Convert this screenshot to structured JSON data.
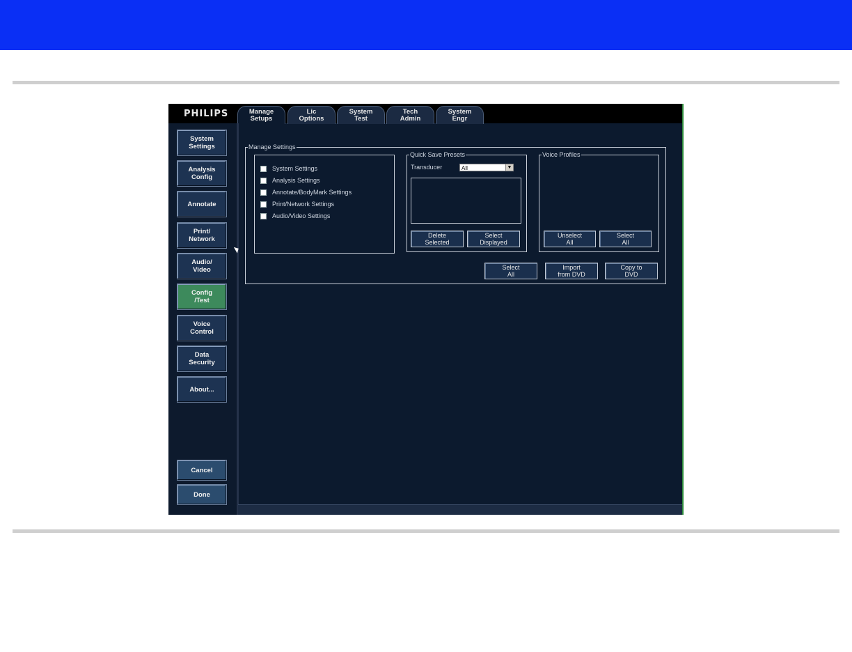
{
  "logo": "PHILIPS",
  "tabs": [
    {
      "line1": "Manage",
      "line2": "Setups"
    },
    {
      "line1": "Lic",
      "line2": "Options"
    },
    {
      "line1": "System",
      "line2": "Test"
    },
    {
      "line1": "Tech",
      "line2": "Admin"
    },
    {
      "line1": "System",
      "line2": "Engr"
    }
  ],
  "sidebar": {
    "items": [
      {
        "line1": "System",
        "line2": "Settings"
      },
      {
        "line1": "Analysis",
        "line2": "Config"
      },
      {
        "line1": "Annotate",
        "line2": ""
      },
      {
        "line1": "Print/",
        "line2": "Network"
      },
      {
        "line1": "Audio/",
        "line2": "Video"
      },
      {
        "line1": "Config",
        "line2": "/Test"
      },
      {
        "line1": "Voice",
        "line2": "Control"
      },
      {
        "line1": "Data",
        "line2": "Security"
      },
      {
        "line1": "About...",
        "line2": ""
      }
    ],
    "cancel": "Cancel",
    "done": "Done"
  },
  "manage_settings": {
    "legend": "Manage Settings",
    "items": [
      "System Settings",
      "Analysis Settings",
      "Annotate/BodyMark Settings",
      "Print/Network Settings",
      "Audio/Video Settings"
    ]
  },
  "quick_save": {
    "legend": "Quick Save Presets",
    "transducer_label": "Transducer",
    "transducer_value": "All",
    "delete": {
      "line1": "Delete",
      "line2": "Selected"
    },
    "select": {
      "line1": "Select",
      "line2": "Displayed"
    }
  },
  "voice_profiles": {
    "legend": "Voice Profiles",
    "unselect": {
      "line1": "Unselect",
      "line2": "All"
    },
    "select": {
      "line1": "Select",
      "line2": "All"
    }
  },
  "bottom_buttons": [
    {
      "line1": "Select",
      "line2": "All"
    },
    {
      "line1": "Import",
      "line2": "from DVD"
    },
    {
      "line1": "Copy to",
      "line2": "DVD"
    }
  ],
  "colors": {
    "header": "#0a2ff5",
    "active_tab_bg": "#0c1a2e",
    "active_side": "#3d8a5c"
  }
}
